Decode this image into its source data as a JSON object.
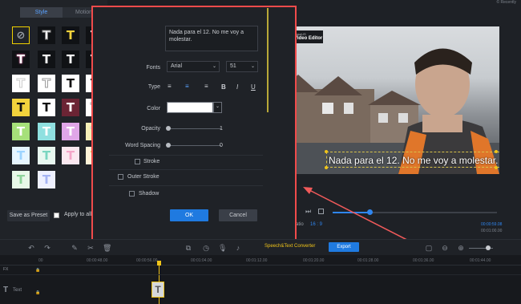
{
  "left_panel": {
    "tabs": [
      "Style",
      "Motion"
    ],
    "save_preset_label": "Save as Preset",
    "apply_all_label": "Apply to all"
  },
  "dialog": {
    "text_value": "Nada para el 12. No me voy a molestar.",
    "fonts_label": "Fonts",
    "font_value": "Arial",
    "font_size_value": "51",
    "type_label": "Type",
    "type_buttons": [
      "align-left",
      "align-center",
      "align-right",
      "B",
      "I",
      "U"
    ],
    "color_label": "Color",
    "opacity_label": "Opacity",
    "opacity_value": "1",
    "spacing_label": "Word Spacing",
    "spacing_value": "0",
    "stroke_label": "Stroke",
    "outer_stroke_label": "Outer Stroke",
    "shadow_label": "Shadow",
    "ok_label": "OK",
    "cancel_label": "Cancel"
  },
  "preview": {
    "logo_line1": "EaseUS",
    "logo_line2": "Video Editor",
    "subtitle": "Nada para el 12. No me voy a molestar.",
    "aspect_label": "Aspect ratio",
    "aspect_value": "16 : 9",
    "time_current": "00:00:59.08",
    "time_total": "00:01:00.00",
    "top_hint": "© Recently"
  },
  "toolbar": {
    "speech_label": "Speech&Text Converter",
    "export_label": "Export"
  },
  "timeline": {
    "ticks": [
      "00",
      "00:00:48.00",
      "00:00:56.00",
      "00:01:04.00",
      "00:01:12.00",
      "00:01:20.00",
      "00:01:28.00",
      "00:01:36.00",
      "00:01:44.00"
    ],
    "track_top_label": "FX",
    "track_text_label": "Text"
  },
  "colors": {
    "accent": "#1f7ae0",
    "highlight_border": "#f04b4b",
    "playhead": "#f0c419"
  }
}
